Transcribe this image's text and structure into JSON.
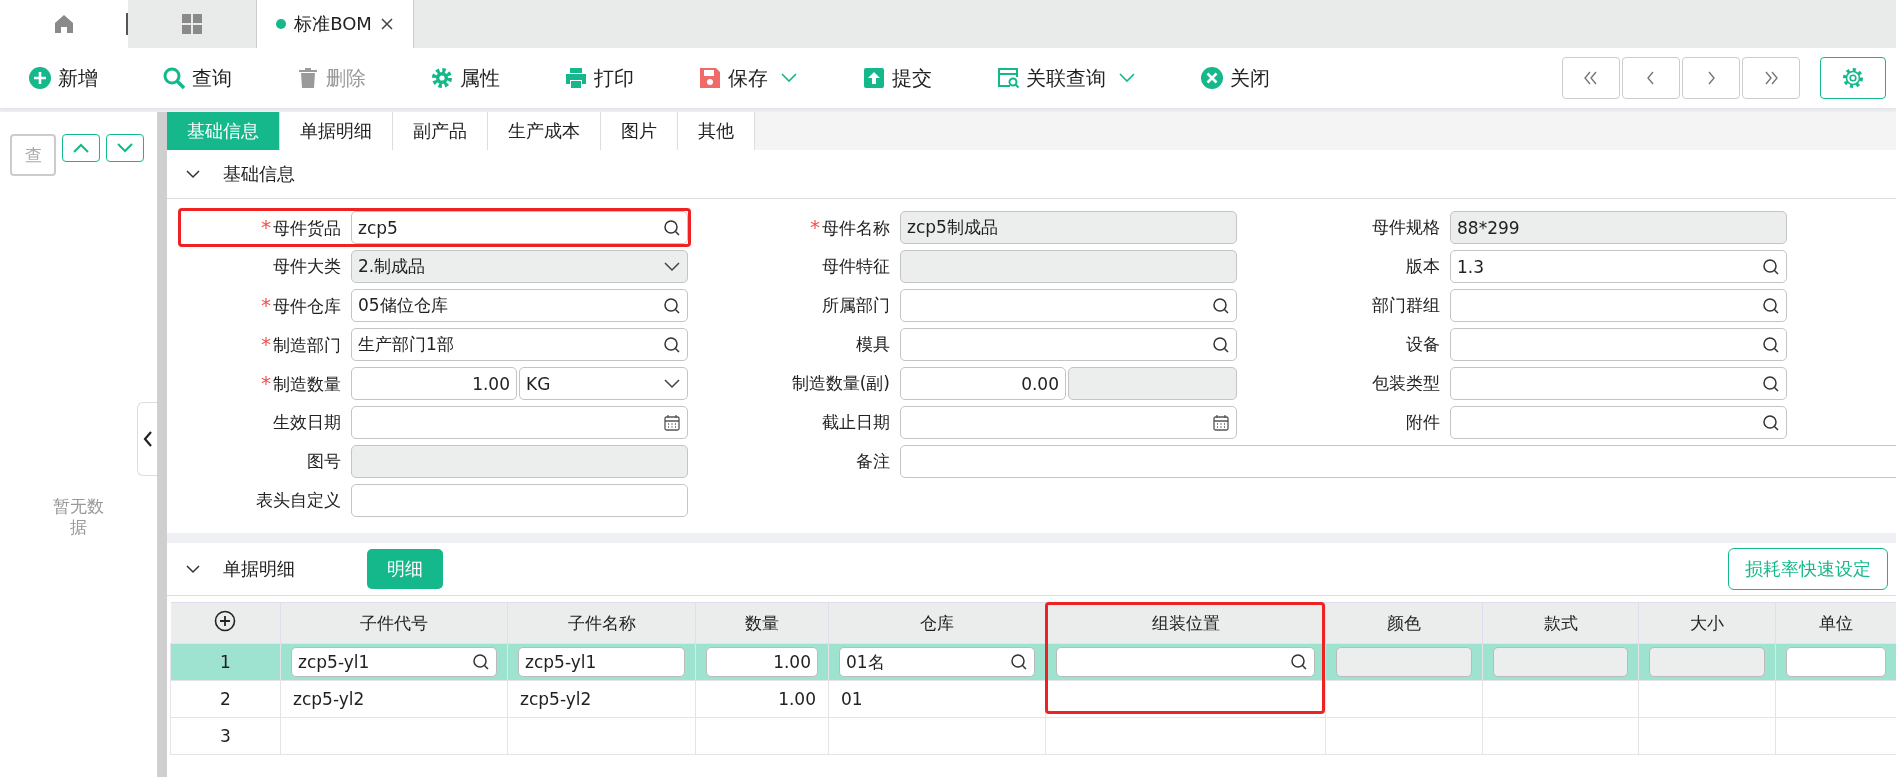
{
  "top_tabs": [
    {
      "kind": "home"
    },
    {
      "kind": "apps"
    },
    {
      "kind": "document",
      "label": "标准BOM"
    }
  ],
  "required_marker": "*",
  "toolbar": [
    {
      "kind": "add",
      "label": "新增",
      "disabled": false,
      "dropdown": false
    },
    {
      "kind": "search",
      "label": "查询",
      "disabled": false,
      "dropdown": false
    },
    {
      "kind": "trash",
      "label": "删除",
      "disabled": true,
      "dropdown": false
    },
    {
      "kind": "gear",
      "label": "属性",
      "disabled": false,
      "dropdown": false
    },
    {
      "kind": "print",
      "label": "打印",
      "disabled": false,
      "dropdown": false
    },
    {
      "kind": "save",
      "label": "保存",
      "disabled": false,
      "dropdown": true
    },
    {
      "kind": "submit",
      "label": "提交",
      "disabled": false,
      "dropdown": false
    },
    {
      "kind": "related",
      "label": "关联查询",
      "disabled": false,
      "dropdown": true
    },
    {
      "kind": "close",
      "label": "关闭",
      "disabled": false,
      "dropdown": false
    }
  ],
  "side_panel": {
    "search_button": "查",
    "empty_text": "暂无数据"
  },
  "sub_tabs": [
    {
      "label": "基础信息",
      "selected": true
    },
    {
      "label": "单据明细",
      "selected": false
    },
    {
      "label": "副产品",
      "selected": false
    },
    {
      "label": "生产成本",
      "selected": false
    },
    {
      "label": "图片",
      "selected": false
    },
    {
      "label": "其他",
      "selected": false
    }
  ],
  "header_section": {
    "title": "基础信息",
    "expanded": true,
    "rows": [
      [
        {
          "label": "母件货品",
          "required": true,
          "highlighted": true,
          "kind": "search",
          "disabled": false,
          "value": "zcp5"
        },
        {
          "label": "母件名称",
          "required": true,
          "highlighted": false,
          "kind": "text",
          "disabled": true,
          "value": "zcp5制成品"
        },
        {
          "label": "母件规格",
          "required": false,
          "highlighted": false,
          "kind": "text",
          "disabled": true,
          "value": "88*299"
        }
      ],
      [
        {
          "label": "母件大类",
          "required": false,
          "highlighted": false,
          "kind": "select",
          "disabled": true,
          "value": "2.制成品"
        },
        {
          "label": "母件特征",
          "required": false,
          "highlighted": false,
          "kind": "text",
          "disabled": true
        },
        {
          "label": "版本",
          "required": false,
          "highlighted": false,
          "kind": "search",
          "disabled": false,
          "value": "1.3"
        }
      ],
      [
        {
          "label": "母件仓库",
          "required": true,
          "highlighted": false,
          "kind": "search",
          "disabled": false,
          "value": "05储位仓库"
        },
        {
          "label": "所属部门",
          "required": false,
          "highlighted": false,
          "kind": "search",
          "disabled": false
        },
        {
          "label": "部门群组",
          "required": false,
          "highlighted": false,
          "kind": "search",
          "disabled": false
        }
      ],
      [
        {
          "label": "制造部门",
          "required": true,
          "highlighted": false,
          "kind": "search",
          "disabled": false,
          "value": "生产部门1部"
        },
        {
          "label": "模具",
          "required": false,
          "highlighted": false,
          "kind": "search",
          "disabled": false
        },
        {
          "label": "设备",
          "required": false,
          "highlighted": false,
          "kind": "search",
          "disabled": false
        }
      ],
      [
        {
          "label": "制造数量",
          "required": true,
          "highlighted": false,
          "kind": "quantity",
          "disabled": false,
          "value": "1.00",
          "unit": {
            "kind": "select",
            "disabled": false,
            "value": "KG"
          }
        },
        {
          "label": "制造数量(副)",
          "required": false,
          "highlighted": false,
          "kind": "quantity",
          "disabled": false,
          "value": "0.00",
          "unit": {
            "kind": "text",
            "disabled": true
          }
        },
        {
          "label": "包装类型",
          "required": false,
          "highlighted": false,
          "kind": "search",
          "disabled": false
        }
      ],
      [
        {
          "label": "生效日期",
          "required": false,
          "highlighted": false,
          "kind": "date",
          "disabled": false
        },
        {
          "label": "截止日期",
          "required": false,
          "highlighted": false,
          "kind": "date",
          "disabled": false
        },
        {
          "label": "附件",
          "required": false,
          "highlighted": false,
          "kind": "search",
          "disabled": false
        }
      ],
      [
        {
          "label": "图号",
          "required": false,
          "highlighted": false,
          "kind": "text",
          "disabled": true
        },
        {
          "label": "备注",
          "required": false,
          "highlighted": false,
          "kind": "wide",
          "disabled": false
        }
      ],
      [
        {
          "label": "表头自定义",
          "required": false,
          "highlighted": false,
          "kind": "text",
          "disabled": false
        }
      ]
    ]
  },
  "detail_section": {
    "title": "单据明细",
    "expanded": true,
    "tag_button": "明细",
    "action_button": "损耗率快速设定"
  },
  "table": {
    "columns": [
      {
        "label": "子件代号",
        "highlighted": false
      },
      {
        "label": "子件名称",
        "highlighted": false
      },
      {
        "label": "数量",
        "highlighted": false
      },
      {
        "label": "仓库",
        "highlighted": false
      },
      {
        "label": "组装位置",
        "highlighted": true
      },
      {
        "label": "颜色",
        "highlighted": false
      },
      {
        "label": "款式",
        "highlighted": false
      },
      {
        "label": "大小",
        "highlighted": false
      },
      {
        "label": "单位",
        "highlighted": false
      }
    ],
    "rows": [
      {
        "number": "1",
        "selected": true,
        "cells": [
          {
            "kind": "search",
            "value": "zcp5-yl1"
          },
          {
            "kind": "text",
            "value": "zcp5-yl1"
          },
          {
            "kind": "number",
            "value": "1.00"
          },
          {
            "kind": "search",
            "value": "01名"
          },
          {
            "kind": "search"
          },
          {
            "kind": "disabled"
          },
          {
            "kind": "disabled"
          },
          {
            "kind": "disabled"
          },
          {
            "kind": "text"
          }
        ]
      },
      {
        "number": "2",
        "selected": false,
        "cells": [
          {
            "kind": "text",
            "value": "zcp5-yl2"
          },
          {
            "kind": "text",
            "value": "zcp5-yl2"
          },
          {
            "kind": "number",
            "value": "1.00"
          },
          {
            "kind": "text",
            "value": "01"
          },
          {
            "kind": "text"
          },
          {
            "kind": "text"
          },
          {
            "kind": "text"
          },
          {
            "kind": "text"
          },
          {
            "kind": "text"
          }
        ]
      },
      {
        "number": "3",
        "selected": false,
        "cells": []
      }
    ]
  }
}
